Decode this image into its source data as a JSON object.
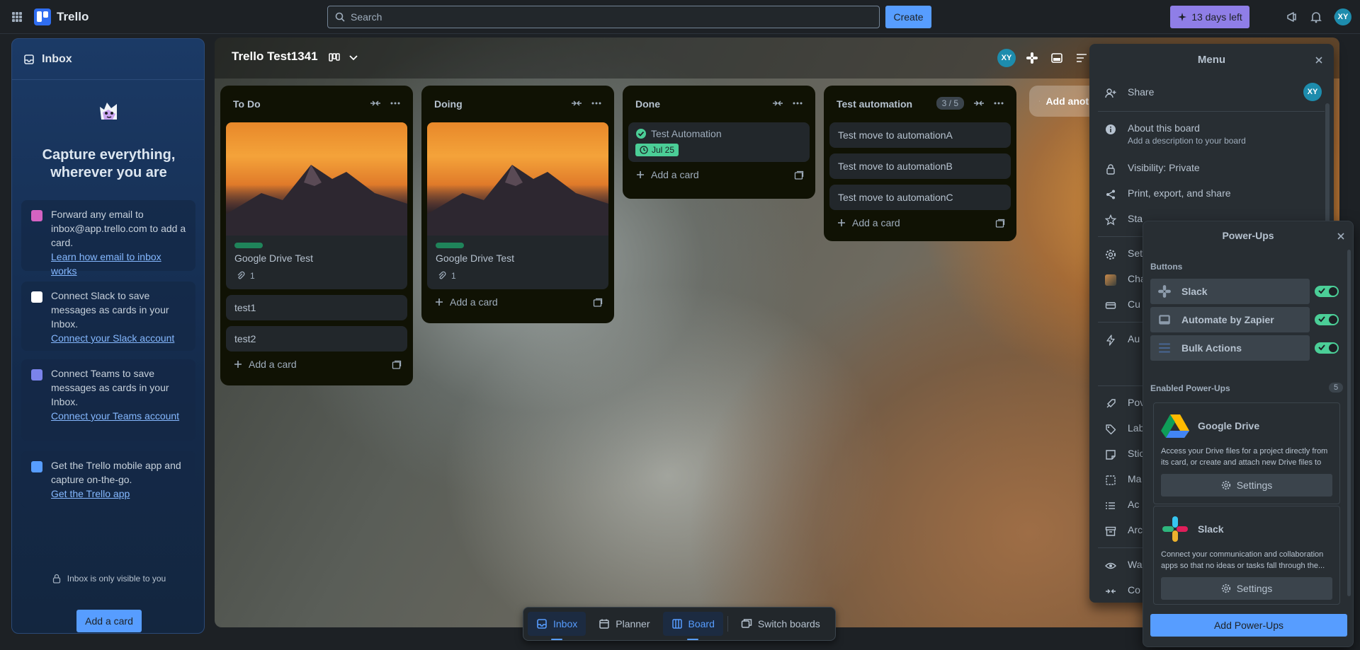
{
  "app": {
    "name": "Trello"
  },
  "topbar": {
    "search_placeholder": "Search",
    "create_label": "Create",
    "trial_label": "13 days left",
    "avatar_initials": "XY"
  },
  "inbox": {
    "title": "Inbox",
    "headline": "Capture everything, wherever you are",
    "cards": [
      {
        "text": "Forward any email to inbox@app.trello.com to add a card.",
        "link": "Learn how email to inbox works"
      },
      {
        "text": "Connect Slack to save messages as cards in your Inbox.",
        "link": "Connect your Slack account"
      },
      {
        "text": "Connect Teams to save messages as cards in your Inbox.",
        "link": "Connect your Teams account"
      },
      {
        "text": "Get the Trello mobile app and capture on-the-go.",
        "link": "Get the Trello app"
      }
    ],
    "private_note": "Inbox is only visible to you",
    "add_button": "Add a card"
  },
  "board": {
    "title": "Trello Test1341",
    "add_list_label": "Add another list",
    "lists": [
      {
        "title": "To Do",
        "cards": [
          "Google Drive Test",
          "test1",
          "test2"
        ],
        "attachment_count": "1",
        "add_label": "Add a card"
      },
      {
        "title": "Doing",
        "cards": [
          "Google Drive Test"
        ],
        "attachment_count": "1",
        "add_label": "Add a card"
      },
      {
        "title": "Done",
        "cards": [
          "Test Automation"
        ],
        "due_date": "Jul 25",
        "add_label": "Add a card"
      },
      {
        "title": "Test automation",
        "count": "3 / 5",
        "cards": [
          "Test move to automationA",
          "Test move to automationB",
          "Test move to automationC"
        ],
        "add_label": "Add a card"
      }
    ]
  },
  "menu": {
    "title": "Menu",
    "items": {
      "share": "Share",
      "about": "About this board",
      "about_sub": "Add a description to your board",
      "visibility": "Visibility: Private",
      "print": "Print, export, and share",
      "star": "Sta",
      "settings": "Set",
      "change_bg": "Cha",
      "custom": "Cu",
      "automation": "Au",
      "powerups": "Pov",
      "labels": "Lab",
      "stickers": "Stic",
      "make": "Ma",
      "activity": "Ac",
      "archived": "Arc",
      "watch": "Wa",
      "copy": "Co"
    }
  },
  "powerups": {
    "title": "Power-Ups",
    "buttons_heading": "Buttons",
    "buttons": [
      "Slack",
      "Automate by Zapier",
      "Bulk Actions"
    ],
    "enabled_heading": "Enabled Power-Ups",
    "enabled_count": "5",
    "enabled": [
      {
        "name": "Google Drive",
        "desc": "Access your Drive files for a project directly from its card, or create and attach new Drive files to a...",
        "settings": "Settings"
      },
      {
        "name": "Slack",
        "desc": "Connect your communication and collaboration apps so that no ideas or tasks fall through the...",
        "settings": "Settings"
      }
    ],
    "add_button": "Add Power-Ups"
  },
  "switcher": {
    "inbox": "Inbox",
    "planner": "Planner",
    "board": "Board",
    "switch": "Switch boards"
  },
  "colors": {
    "accent": "#579dff",
    "trial": "#8f7ee7",
    "label_green": "#1f845a",
    "toggle_on": "#4bce97"
  }
}
